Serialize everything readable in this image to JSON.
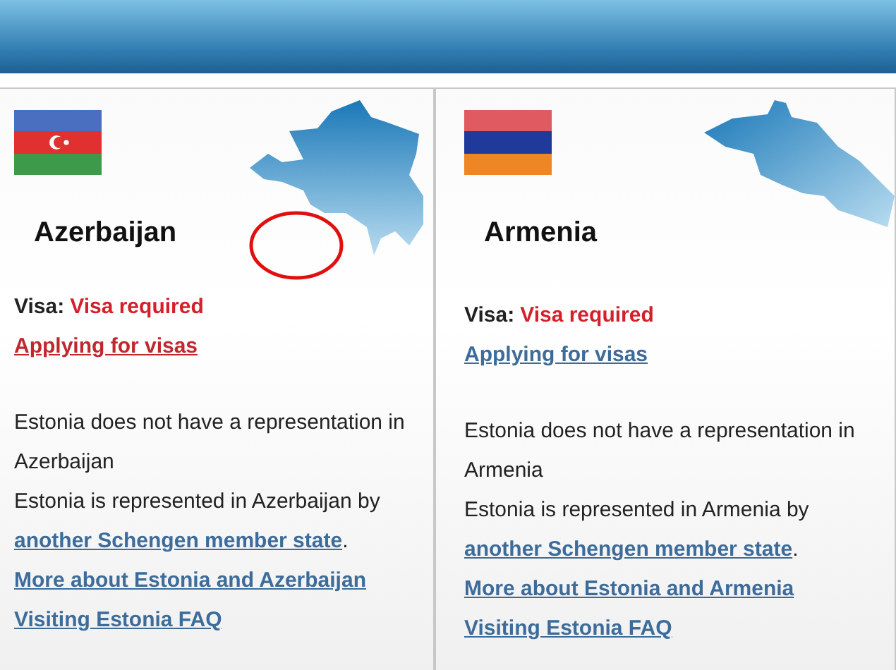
{
  "cards": [
    {
      "kind": "azerbaijan",
      "name": "Azerbaijan",
      "circled": true,
      "visa_label": "Visa:",
      "visa_status": "Visa required",
      "apply_link": {
        "text": "Applying for visas",
        "color": "#c0282d"
      },
      "no_representation": "Estonia does not have a representation in Azerbaijan",
      "represented": {
        "before": "Estonia is represented in Azerbaijan by",
        "link": "another Schengen member state",
        "after": "."
      },
      "links": [
        "More about Estonia and Azerbaijan",
        "Visiting Estonia FAQ"
      ]
    },
    {
      "kind": "armenia",
      "name": "Armenia",
      "circled": false,
      "visa_label": "Visa:",
      "visa_status": "Visa required",
      "apply_link": {
        "text": "Applying for visas",
        "color": "#3d6c9a"
      },
      "no_representation": "Estonia does not have a representation in Armenia",
      "represented": {
        "before": "Estonia is represented in Armenia by",
        "link": "another Schengen member state",
        "after": "."
      },
      "links": [
        "More about Estonia and Armenia",
        "Visiting Estonia FAQ"
      ]
    }
  ]
}
